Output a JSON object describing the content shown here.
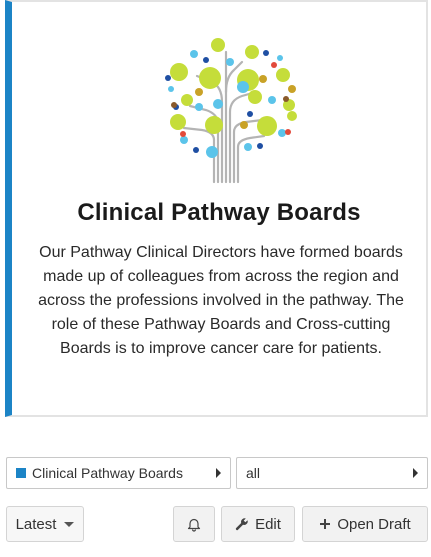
{
  "card": {
    "title": "Clinical Pathway Boards",
    "description": "Our Pathway Clinical Directors have formed boards made up of colleagues from across the region and across the professions involved in the pathway. The role of these Pathway Boards and Cross-cutting Boards is to improve cancer care for patients.",
    "logo_icon": "tree-of-dots-icon",
    "accent_color": "#1c84c6"
  },
  "selectors": {
    "board": "Clinical Pathway Boards",
    "filter": "all"
  },
  "toolbar": {
    "version_label": "Latest",
    "notify_icon": "bell-icon",
    "edit_label": "Edit",
    "open_draft_label": "Open Draft"
  },
  "colors": {
    "lime": "#c5dd3a",
    "sky": "#5bc4ea",
    "navy": "#1f4fa3",
    "gold": "#c9a227",
    "red": "#e24a3b",
    "brown": "#8a5a2b",
    "trunk": "#b4b4b4"
  }
}
